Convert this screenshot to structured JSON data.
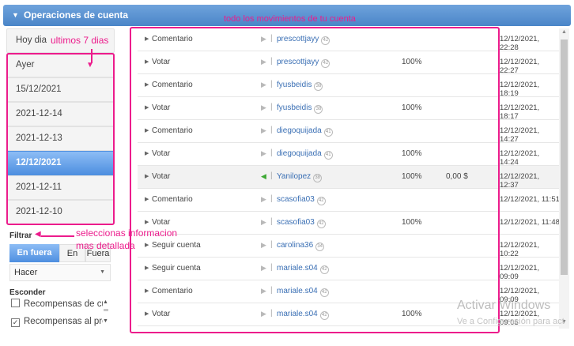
{
  "header": {
    "title": "Operaciones de cuenta",
    "toggle_icon": "caret-down-icon"
  },
  "sidebar": {
    "dates": [
      "Hoy dia",
      "Ayer",
      "15/12/2021",
      "2021-12-14",
      "2021-12-13",
      "12/12/2021",
      "2021-12-11",
      "2021-12-10"
    ],
    "active_date": "12/12/2021",
    "filter_label": "Filtrar",
    "filter_toggle": [
      "En fuera",
      "En",
      "Fuera"
    ],
    "select_value": "Hacer",
    "hide_label": "Esconder",
    "hide_options": [
      {
        "label": "Recompensas de cu",
        "checked": false
      },
      {
        "label": "Recompensas al prc",
        "checked": true
      }
    ]
  },
  "activity": {
    "rows": [
      {
        "type": "Comentario",
        "user": "prescottjayy",
        "rep": "42",
        "percent": "",
        "amount": "",
        "date": "12/12/2021, 22:28"
      },
      {
        "type": "Votar",
        "user": "prescottjayy",
        "rep": "42",
        "percent": "100%",
        "amount": "",
        "date": "12/12/2021, 22:27"
      },
      {
        "type": "Comentario",
        "user": "fyusbeidis",
        "rep": "38",
        "percent": "",
        "amount": "",
        "date": "12/12/2021, 18:19"
      },
      {
        "type": "Votar",
        "user": "fyusbeidis",
        "rep": "38",
        "percent": "100%",
        "amount": "",
        "date": "12/12/2021, 18:17"
      },
      {
        "type": "Comentario",
        "user": "diegoquijada",
        "rep": "41",
        "percent": "",
        "amount": "",
        "date": "12/12/2021, 14:27"
      },
      {
        "type": "Votar",
        "user": "diegoquijada",
        "rep": "41",
        "percent": "100%",
        "amount": "",
        "date": "12/12/2021, 14:24"
      },
      {
        "type": "Votar",
        "user": "Yanilopez",
        "rep": "38",
        "percent": "100%",
        "amount": "0,00 $",
        "date": "12/12/2021, 12:37",
        "highlight": true
      },
      {
        "type": "Comentario",
        "user": "scasofia03",
        "rep": "42",
        "percent": "",
        "amount": "",
        "date": "12/12/2021, 11:51"
      },
      {
        "type": "Votar",
        "user": "scasofia03",
        "rep": "42",
        "percent": "100%",
        "amount": "",
        "date": "12/12/2021, 11:48"
      },
      {
        "type": "Seguir cuenta",
        "user": "carolina36",
        "rep": "34",
        "percent": "",
        "amount": "",
        "date": "12/12/2021, 10:22"
      },
      {
        "type": "Seguir cuenta",
        "user": "mariale.s04",
        "rep": "42",
        "percent": "",
        "amount": "",
        "date": "12/12/2021, 09:09"
      },
      {
        "type": "Comentario",
        "user": "mariale.s04",
        "rep": "42",
        "percent": "",
        "amount": "",
        "date": "12/12/2021, 09:09"
      },
      {
        "type": "Votar",
        "user": "mariale.s04",
        "rep": "42",
        "percent": "100%",
        "amount": "",
        "date": "12/12/2021, 09:05"
      }
    ]
  },
  "annotations": {
    "top": "todo los movimientos de tu cuenta",
    "sidebar": "ultimos 7 dias",
    "filter_line1": "seleccionas informacion",
    "filter_line2": "mas detallada",
    "color": "#ec1c8c"
  },
  "watermark": {
    "line1": "Activar Windows",
    "line2": "Ve a Configuración para act"
  },
  "colors": {
    "header": "#4a85c8",
    "active": "#4e8fe0",
    "link": "#3a6fb4",
    "green_play": "#3fa935"
  }
}
